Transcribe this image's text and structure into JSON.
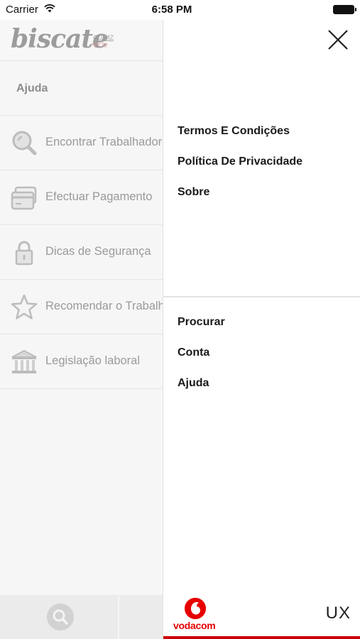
{
  "status_bar": {
    "carrier": "Carrier",
    "time": "6:58 PM"
  },
  "left": {
    "logo": {
      "text": "biscate",
      "domain": "CO.MZ",
      "code": "*777#"
    },
    "ajuda": "Ajuda",
    "items": [
      {
        "label": "Encontrar Trabalhadores",
        "icon": "search-icon"
      },
      {
        "label": "Efectuar Pagamento",
        "icon": "credit-card-icon"
      },
      {
        "label": "Dicas de Segurança",
        "icon": "lock-icon"
      },
      {
        "label": "Recomendar o Trabalhador",
        "icon": "star-icon"
      },
      {
        "label": "Legislação laboral",
        "icon": "bank-icon"
      }
    ]
  },
  "drawer": {
    "group1": [
      {
        "label": "Termos E Condições"
      },
      {
        "label": "Política De Privacidade"
      },
      {
        "label": "Sobre"
      }
    ],
    "group2": [
      {
        "label": "Procurar"
      },
      {
        "label": "Conta"
      },
      {
        "label": "Ajuda"
      }
    ],
    "footer": {
      "brand": "vodacom",
      "partner": "UX"
    }
  },
  "colors": {
    "accent": "#cc0000",
    "vodafone_red": "#e60000"
  }
}
